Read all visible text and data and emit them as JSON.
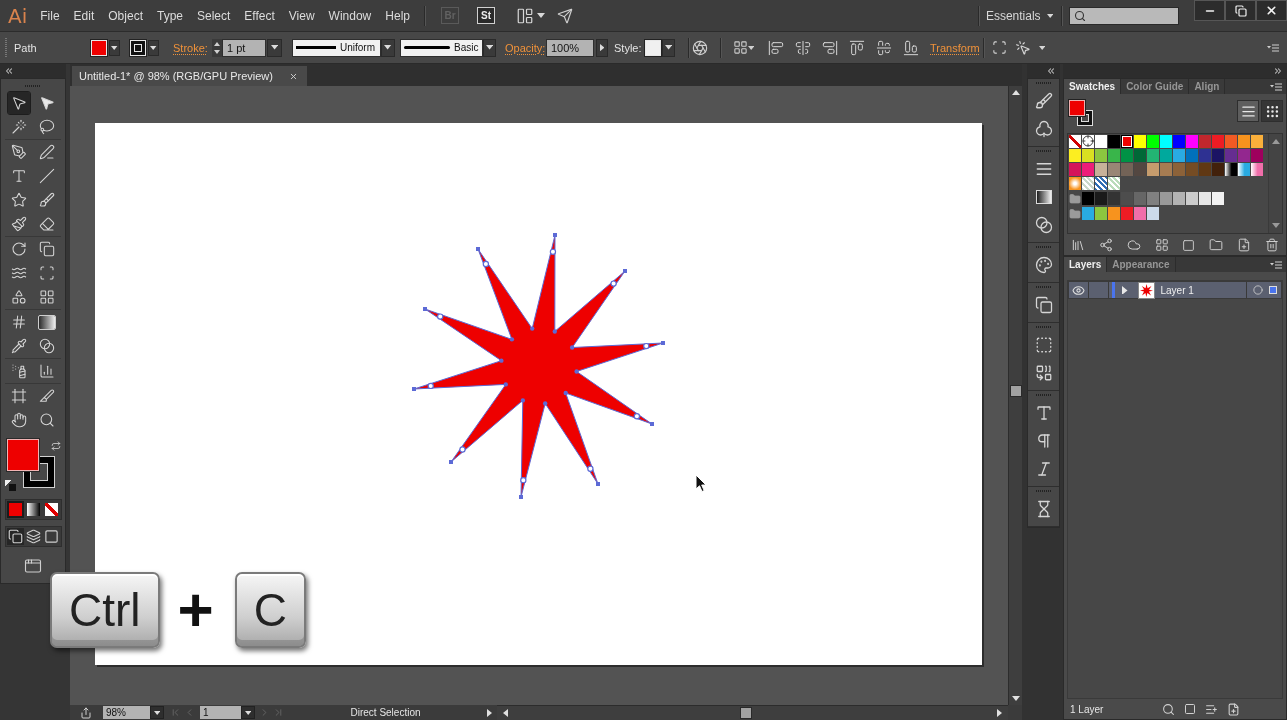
{
  "menu_bar": {
    "logo": "Ai",
    "menus": [
      "File",
      "Edit",
      "Object",
      "Type",
      "Select",
      "Effect",
      "View",
      "Window",
      "Help"
    ],
    "app_buttons": [
      {
        "label": "Br",
        "disabled": true
      },
      {
        "label": "St",
        "disabled": false
      }
    ],
    "workspace": "Essentials"
  },
  "control_bar": {
    "selection": "Path",
    "stroke_label": "Stroke:",
    "stroke_weight": "1 pt",
    "profile": "Uniform",
    "brush": "Basic",
    "opacity_label": "Opacity:",
    "opacity": "100%",
    "style_label": "Style:",
    "transform": "Transform"
  },
  "tool_groups": [
    {
      "tools": [
        {
          "selected": true
        },
        {
          "selected": false
        },
        {
          "selected": false
        },
        {
          "selected": false
        }
      ]
    },
    {
      "tools": [
        {
          "selected": false
        },
        {
          "selected": false
        },
        {
          "selected": false
        },
        {
          "selected": false
        },
        {
          "selected": false
        },
        {
          "selected": false
        },
        {
          "selected": false
        },
        {
          "selected": false
        }
      ]
    },
    {
      "tools": [
        {
          "selected": false
        },
        {
          "selected": false
        },
        {
          "selected": false
        },
        {
          "selected": false
        },
        {
          "selected": false
        },
        {
          "selected": false
        }
      ]
    },
    {
      "tools": [
        {
          "selected": false
        },
        {
          "selected": false
        },
        {
          "selected": false
        },
        {
          "selected": false
        }
      ]
    },
    {
      "tools": [
        {
          "selected": false
        },
        {
          "selected": false
        }
      ]
    },
    {
      "tools": [
        {
          "selected": false
        },
        {
          "selected": false
        },
        {
          "selected": false
        },
        {
          "selected": false
        }
      ]
    }
  ],
  "fill_stroke": {
    "modes": [
      {
        "kind": "color",
        "selected": true
      },
      {
        "kind": "gradient",
        "selected": false
      },
      {
        "kind": "none",
        "selected": false
      }
    ],
    "draw_modes": [
      {
        "kind": "normal",
        "selected": true
      },
      {
        "kind": "behind",
        "selected": false
      },
      {
        "kind": "inside",
        "selected": false
      }
    ]
  },
  "document_tabs": [
    {
      "title": "Untitled-1* @ 98% (RGB/GPU Preview)",
      "selected": true
    }
  ],
  "status_bar": {
    "zoom": "98%",
    "artboard": "1",
    "tool": "Direct Selection"
  },
  "swatches_panel": {
    "tabs": [
      {
        "label": "Swatches",
        "selected": true
      },
      {
        "label": "Color Guide",
        "selected": false
      },
      {
        "label": "Align",
        "selected": false
      }
    ],
    "views": [
      {
        "kind": "list",
        "selected": false
      },
      {
        "kind": "grid",
        "selected": true
      }
    ],
    "swatches": [
      {
        "kind": "none",
        "selected": false
      },
      {
        "kind": "registration",
        "selected": false
      },
      {
        "kind": "color",
        "color": "#ffffff",
        "selected": false
      },
      {
        "kind": "color",
        "color": "#000000",
        "selected": false
      },
      {
        "kind": "color",
        "color": "#ee0000",
        "selected": true
      },
      {
        "kind": "color",
        "color": "#ffff00",
        "selected": false
      },
      {
        "kind": "color",
        "color": "#00ff00",
        "selected": false
      },
      {
        "kind": "color",
        "color": "#00ffff",
        "selected": false
      },
      {
        "kind": "color",
        "color": "#0000ff",
        "selected": false
      },
      {
        "kind": "color",
        "color": "#ff00ff",
        "selected": false
      },
      {
        "kind": "color",
        "color": "#c1272d",
        "selected": false
      },
      {
        "kind": "color",
        "color": "#ed1c24",
        "selected": false
      },
      {
        "kind": "color",
        "color": "#f15a24",
        "selected": false
      },
      {
        "kind": "color",
        "color": "#f7931e",
        "selected": false
      },
      {
        "kind": "color",
        "color": "#fbb03b",
        "selected": false
      },
      {
        "kind": "color",
        "color": "#fcee21",
        "selected": false
      },
      {
        "kind": "color",
        "color": "#d9e021",
        "selected": false
      },
      {
        "kind": "color",
        "color": "#8cc63f",
        "selected": false
      },
      {
        "kind": "color",
        "color": "#39b54a",
        "selected": false
      },
      {
        "kind": "color",
        "color": "#009245",
        "selected": false
      },
      {
        "kind": "color",
        "color": "#006837",
        "selected": false
      },
      {
        "kind": "color",
        "color": "#22b573",
        "selected": false
      },
      {
        "kind": "color",
        "color": "#00a99d",
        "selected": false
      },
      {
        "kind": "color",
        "color": "#29abe2",
        "selected": false
      },
      {
        "kind": "color",
        "color": "#0071bc",
        "selected": false
      },
      {
        "kind": "color",
        "color": "#2e3192",
        "selected": false
      },
      {
        "kind": "color",
        "color": "#1b1464",
        "selected": false
      },
      {
        "kind": "color",
        "color": "#662d91",
        "selected": false
      },
      {
        "kind": "color",
        "color": "#93278f",
        "selected": false
      },
      {
        "kind": "color",
        "color": "#9e005d",
        "selected": false
      },
      {
        "kind": "color",
        "color": "#d4145a",
        "selected": false
      },
      {
        "kind": "color",
        "color": "#ed1e79",
        "selected": false
      },
      {
        "kind": "color",
        "color": "#c7b299",
        "selected": false
      },
      {
        "kind": "color",
        "color": "#998675",
        "selected": false
      },
      {
        "kind": "color",
        "color": "#736357",
        "selected": false
      },
      {
        "kind": "color",
        "color": "#534741",
        "selected": false
      },
      {
        "kind": "color",
        "color": "#c69c6d",
        "selected": false
      },
      {
        "kind": "color",
        "color": "#a67c52",
        "selected": false
      },
      {
        "kind": "color",
        "color": "#8c6239",
        "selected": false
      },
      {
        "kind": "color",
        "color": "#754c24",
        "selected": false
      },
      {
        "kind": "color",
        "color": "#603813",
        "selected": false
      },
      {
        "kind": "color",
        "color": "#42210b",
        "selected": false
      },
      {
        "kind": "gradient",
        "color": "#000000",
        "selected": false
      },
      {
        "kind": "gradient",
        "color": "#29abe2",
        "selected": false
      },
      {
        "kind": "gradient",
        "color": "#f06eaa",
        "selected": false
      },
      {
        "kind": "radial_gradient",
        "color": "#f7931e",
        "selected": false
      },
      {
        "kind": "pattern",
        "color": "#c9d9c9",
        "selected": false
      },
      {
        "kind": "pattern",
        "color": "#2f6fb5",
        "selected": false
      },
      {
        "kind": "pattern",
        "color": "#b9dcb9",
        "selected": false
      }
    ],
    "groups": [
      {
        "swatches": [
          {
            "kind": "color",
            "color": "#000000",
            "selected": false
          },
          {
            "kind": "color",
            "color": "#1a1a1a",
            "selected": false
          },
          {
            "kind": "color",
            "color": "#333333",
            "selected": false
          },
          {
            "kind": "color",
            "color": "#4d4d4d",
            "selected": false
          },
          {
            "kind": "color",
            "color": "#666666",
            "selected": false
          },
          {
            "kind": "color",
            "color": "#808080",
            "selected": false
          },
          {
            "kind": "color",
            "color": "#999999",
            "selected": false
          },
          {
            "kind": "color",
            "color": "#b3b3b3",
            "selected": false
          },
          {
            "kind": "color",
            "color": "#cccccc",
            "selected": false
          },
          {
            "kind": "color",
            "color": "#e6e6e6",
            "selected": false
          },
          {
            "kind": "color",
            "color": "#f2f2f2",
            "selected": false
          }
        ]
      },
      {
        "swatches": [
          {
            "kind": "color",
            "color": "#29abe2",
            "selected": false
          },
          {
            "kind": "color",
            "color": "#8cc63f",
            "selected": false
          },
          {
            "kind": "color",
            "color": "#f7931e",
            "selected": false
          },
          {
            "kind": "color",
            "color": "#ed1c24",
            "selected": false
          },
          {
            "kind": "color",
            "color": "#f06eaa",
            "selected": false
          },
          {
            "kind": "color",
            "color": "#ccdaea",
            "selected": false
          }
        ]
      }
    ]
  },
  "layers_panel": {
    "tabs": [
      {
        "label": "Layers",
        "selected": true
      },
      {
        "label": "Appearance",
        "selected": false
      }
    ],
    "layers": [
      {
        "name": "Layer 1",
        "visible": true,
        "expanded": false,
        "selected": true,
        "color": "#4a74ee"
      }
    ],
    "count": "1 Layer"
  },
  "keystroke_overlay": {
    "keys": [
      "Ctrl",
      "C"
    ],
    "joiner": "+"
  }
}
